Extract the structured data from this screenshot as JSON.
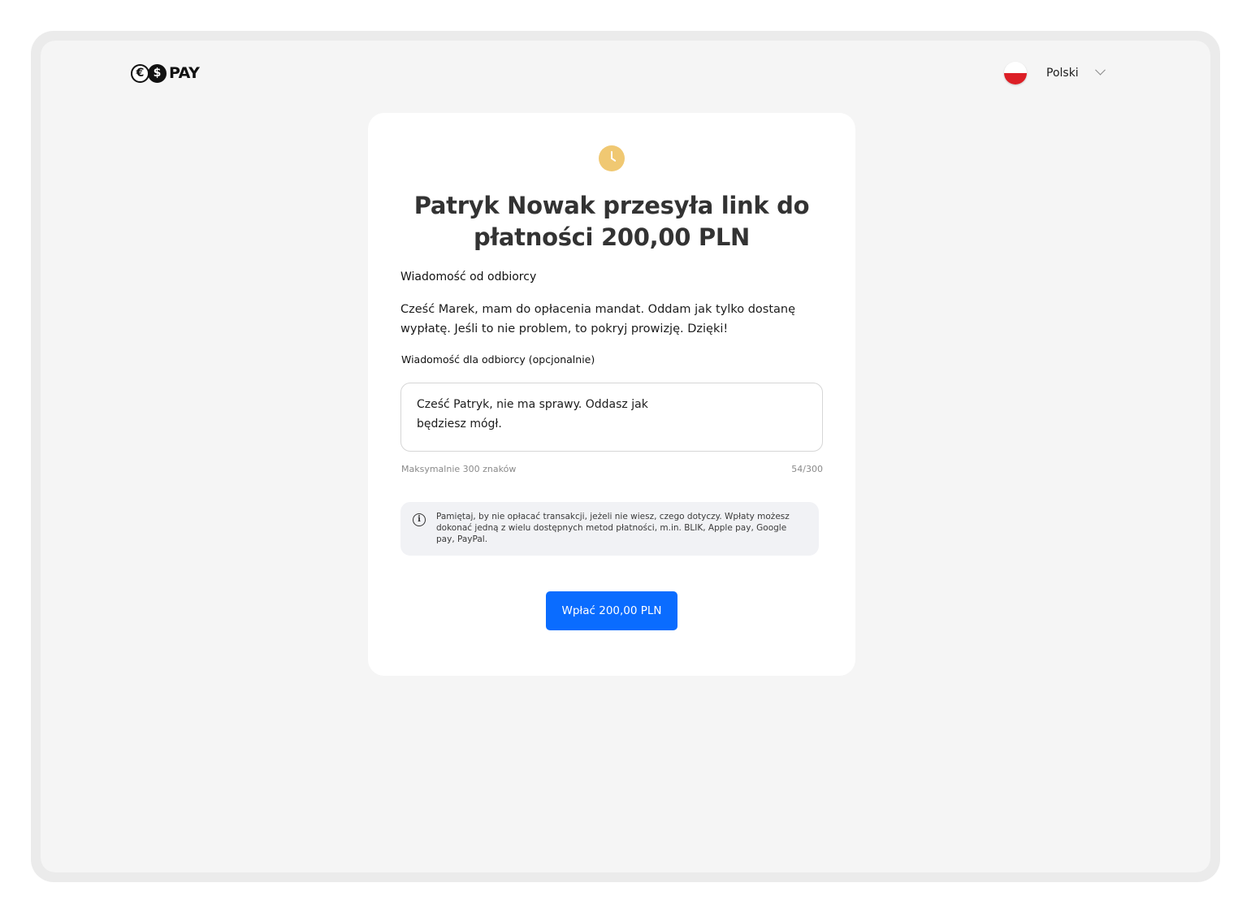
{
  "header": {
    "logo_text": "PAY",
    "logo_coin_euro": "€",
    "logo_coin_dollar": "$",
    "language": {
      "selected": "Polski"
    }
  },
  "card": {
    "title": "Patryk Nowak przesyła link do płatności 200,00 PLN",
    "from_label": "Wiadomość od odbiorcy",
    "from_message": "Cześć Marek, mam do opłacenia mandat. Oddam jak tylko dostanę wypłatę. Jeśli to nie problem, to pokryj prowizję. Dzięki!",
    "to_label": "Wiadomość dla odbiorcy (opcjonalnie)",
    "to_message_value": "Cześć Patryk, nie ma sprawy. Oddasz jak będziesz mógł.",
    "hint": "Maksymalnie 300 znaków",
    "counter": "54/300",
    "info_text": "Pamiętaj, by nie opłacać transakcji, jeżeli nie wiesz, czego dotyczy. Wpłaty możesz dokonać jedną z wielu dostępnych metod płatności, m.in. BLIK, Apple pay, Google pay, PayPal.",
    "info_icon_glyph": "i",
    "pay_button": "Wpłać 200,00 PLN"
  },
  "colors": {
    "primary": "#0a6cff",
    "clock_accent": "#f0c872",
    "flag_red": "#dc1f26"
  }
}
